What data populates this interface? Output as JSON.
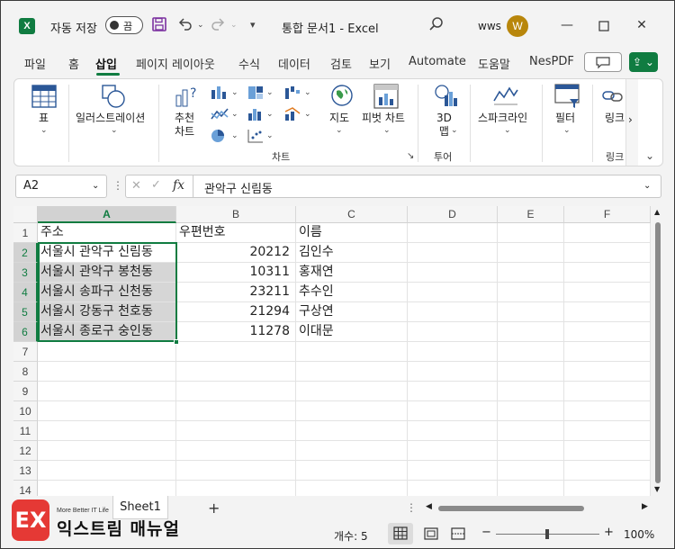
{
  "titlebar": {
    "app_logo": "X",
    "autosave_label": "자동 저장",
    "autosave_state": "끔",
    "doc_title": "통합 문서1  -  Excel",
    "username": "wws",
    "avatar_initial": "W",
    "icons": [
      "save-icon",
      "undo-icon",
      "redo-icon",
      "customize-icon",
      "search-icon",
      "minimize-icon",
      "maximize-icon",
      "close-icon"
    ]
  },
  "menu": {
    "tabs": [
      "파일",
      "홈",
      "삽입",
      "페이지 레이아웃",
      "수식",
      "데이터",
      "검토",
      "보기",
      "Automate",
      "도움말",
      "NesPDF"
    ],
    "active_tab": "삽입"
  },
  "ribbon": {
    "table_label": "표",
    "illustrations_label": "일러스트레이션",
    "recommended_charts_label": "추천\n차트",
    "maps_label": "지도",
    "pivot_chart_label": "피벗 차트",
    "charts_group": "차트",
    "map3d_label": "3D\n맵",
    "tours_group": "투어",
    "sparklines_label": "스파크라인",
    "filter_label": "필터",
    "link_label": "링크",
    "link_group": "링크"
  },
  "formula_bar": {
    "name_box": "A2",
    "fx": "fx",
    "content": "관악구 신림동"
  },
  "sheet": {
    "columns": [
      "A",
      "B",
      "C",
      "D",
      "E",
      "F"
    ],
    "rows": [
      "1",
      "2",
      "3",
      "4",
      "5",
      "6",
      "7",
      "8",
      "9",
      "10",
      "11",
      "12",
      "13",
      "14"
    ],
    "cells": [
      [
        "주소",
        "우편번호",
        "이름"
      ],
      [
        "서울시 관악구 신림동",
        "20212",
        "김인수"
      ],
      [
        "서울시 관악구 봉천동",
        "10311",
        "홍재연"
      ],
      [
        "서울시 송파구 신천동",
        "23211",
        "추수인"
      ],
      [
        "서울시 강동구 천호동",
        "21294",
        "구상연"
      ],
      [
        "서울시 종로구 숭인동",
        "11278",
        "이대문"
      ]
    ]
  },
  "sheet_tabs": {
    "active": "Sheet1",
    "add": "+"
  },
  "status": {
    "count_label": "개수: 5",
    "zoom": "100%",
    "zoom_minus": "−",
    "zoom_plus": "+"
  },
  "watermark": {
    "logo": "EX",
    "tagline": "More Better IT Life",
    "name": "익스트림 매뉴얼"
  },
  "colors": {
    "accent": "#107c41",
    "selection_fill": "#d6d6d6"
  }
}
